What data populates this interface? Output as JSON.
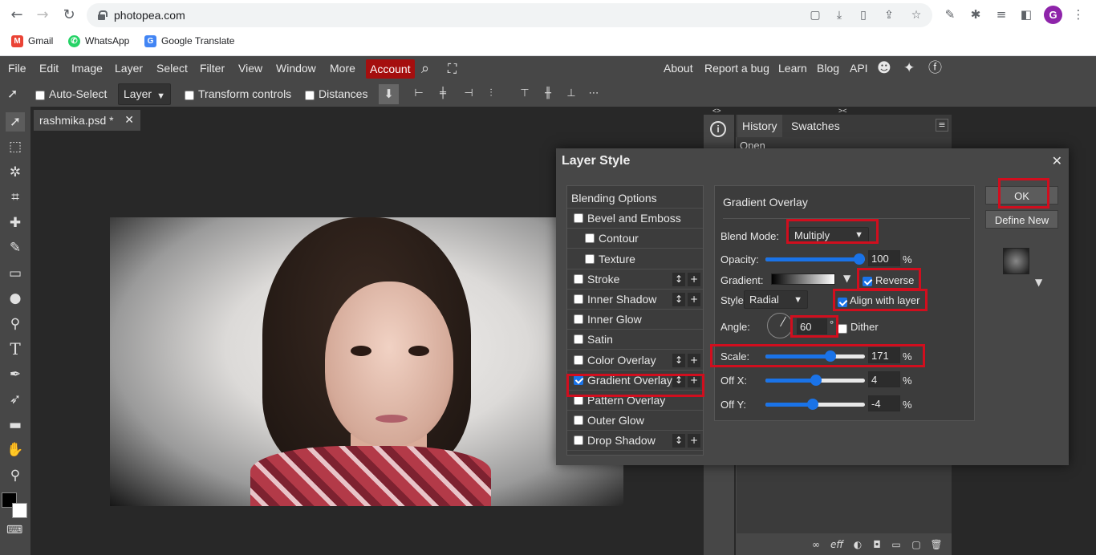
{
  "browser": {
    "url": "photopea.com",
    "bookmarks": [
      {
        "label": "Gmail",
        "color": "#ea4335"
      },
      {
        "label": "WhatsApp",
        "color": "#25d366"
      },
      {
        "label": "Google Translate",
        "color": "#4285f4"
      }
    ],
    "profile_initial": "G"
  },
  "menu": {
    "items": [
      "File",
      "Edit",
      "Image",
      "Layer",
      "Select",
      "Filter",
      "View",
      "Window",
      "More"
    ],
    "account": "Account",
    "right": [
      "About",
      "Report a bug",
      "Learn",
      "Blog",
      "API"
    ]
  },
  "options": {
    "auto_select": "Auto-Select",
    "layer_select": "Layer",
    "transform_controls": "Transform controls",
    "distances": "Distances"
  },
  "document": {
    "tab_name": "rashmika.psd *"
  },
  "right_panel": {
    "tabs": [
      "History",
      "Swatches"
    ],
    "history_items": [
      "Open"
    ]
  },
  "dialog": {
    "title": "Layer Style",
    "styles": [
      {
        "label": "Blending Options",
        "checkbox": false,
        "checked": false,
        "indent": false,
        "buttons": false
      },
      {
        "label": "Bevel and Emboss",
        "checkbox": true,
        "checked": false,
        "indent": false,
        "buttons": false
      },
      {
        "label": "Contour",
        "checkbox": true,
        "checked": false,
        "indent": true,
        "buttons": false
      },
      {
        "label": "Texture",
        "checkbox": true,
        "checked": false,
        "indent": true,
        "buttons": false
      },
      {
        "label": "Stroke",
        "checkbox": true,
        "checked": false,
        "indent": false,
        "buttons": true
      },
      {
        "label": "Inner Shadow",
        "checkbox": true,
        "checked": false,
        "indent": false,
        "buttons": true
      },
      {
        "label": "Inner Glow",
        "checkbox": true,
        "checked": false,
        "indent": false,
        "buttons": false
      },
      {
        "label": "Satin",
        "checkbox": true,
        "checked": false,
        "indent": false,
        "buttons": false
      },
      {
        "label": "Color Overlay",
        "checkbox": true,
        "checked": false,
        "indent": false,
        "buttons": true
      },
      {
        "label": "Gradient Overlay",
        "checkbox": true,
        "checked": true,
        "indent": false,
        "buttons": true
      },
      {
        "label": "Pattern Overlay",
        "checkbox": true,
        "checked": false,
        "indent": false,
        "buttons": false
      },
      {
        "label": "Outer Glow",
        "checkbox": true,
        "checked": false,
        "indent": false,
        "buttons": false
      },
      {
        "label": "Drop Shadow",
        "checkbox": true,
        "checked": false,
        "indent": false,
        "buttons": true
      }
    ],
    "panel_title": "Gradient Overlay",
    "blend_mode_label": "Blend Mode:",
    "blend_mode": "Multiply",
    "opacity_label": "Opacity:",
    "opacity": "100",
    "gradient_label": "Gradient:",
    "reverse_label": "Reverse",
    "style_label": "Style:",
    "style": "Radial",
    "align_label": "Align with layer",
    "angle_label": "Angle:",
    "angle": "60",
    "degree": "°",
    "dither_label": "Dither",
    "scale_label": "Scale:",
    "scale": "171",
    "offx_label": "Off X:",
    "offx": "4",
    "offy_label": "Off Y:",
    "offy": "-4",
    "percent": "%",
    "ok": "OK",
    "define_new": "Define New"
  }
}
